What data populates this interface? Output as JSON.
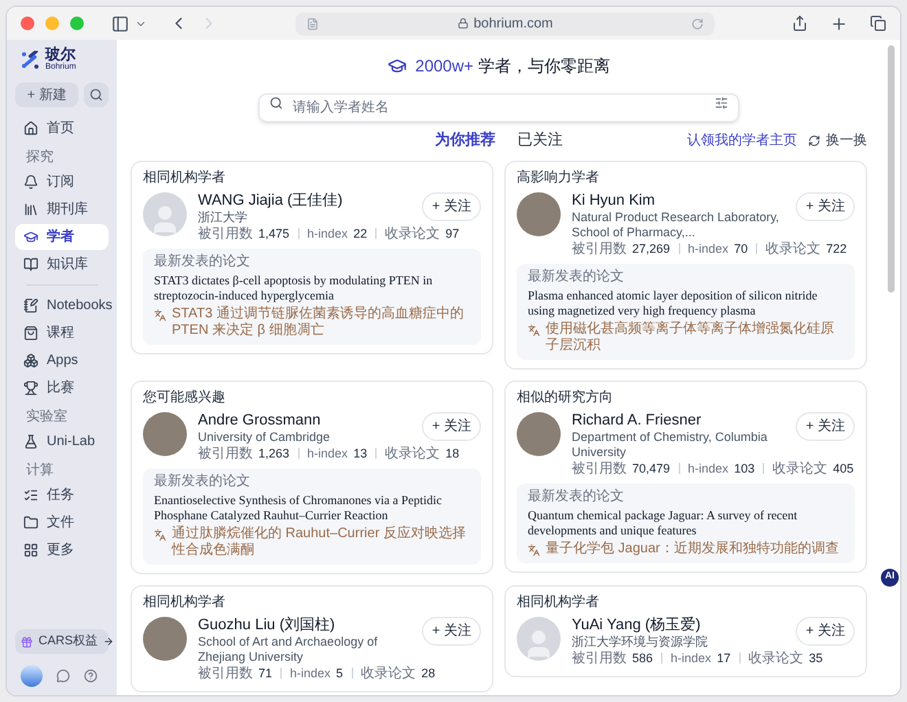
{
  "browser": {
    "address": "bohrium.com"
  },
  "sidebar": {
    "logo": {
      "name": "玻尔",
      "sub": "Bohrium"
    },
    "new_button": "+ 新建",
    "items": [
      {
        "kind": "item",
        "label": "首页",
        "selected": false
      },
      {
        "kind": "section",
        "label": "探究"
      },
      {
        "kind": "item",
        "label": "订阅",
        "selected": false
      },
      {
        "kind": "item",
        "label": "期刊库",
        "selected": false
      },
      {
        "kind": "item",
        "label": "学者",
        "selected": true
      },
      {
        "kind": "item",
        "label": "知识库",
        "selected": false
      },
      {
        "kind": "divider"
      },
      {
        "kind": "item",
        "label": "Notebooks",
        "selected": false
      },
      {
        "kind": "item",
        "label": "课程",
        "selected": false
      },
      {
        "kind": "item",
        "label": "Apps",
        "selected": false
      },
      {
        "kind": "item",
        "label": "比赛",
        "selected": false
      },
      {
        "kind": "section",
        "label": "实验室"
      },
      {
        "kind": "item",
        "label": "Uni-Lab",
        "selected": false
      },
      {
        "kind": "section",
        "label": "计算"
      },
      {
        "kind": "item",
        "label": "任务",
        "selected": false
      },
      {
        "kind": "item",
        "label": "文件",
        "selected": false
      },
      {
        "kind": "item",
        "label": "更多",
        "selected": false
      }
    ],
    "promo": "CARS权益"
  },
  "hero": {
    "highlight": "2000w+",
    "title": " 学者，与你零距离"
  },
  "search": {
    "placeholder": "请输入学者姓名"
  },
  "tabs": [
    {
      "label": "为你推荐",
      "selected": true
    },
    {
      "label": "已关注",
      "selected": false
    }
  ],
  "claim_link": "认领我的学者主页",
  "refresh": "换一换",
  "cards": [
    {
      "category": "相同机构学者",
      "has_photo": false,
      "name": "WANG Jiajia (王佳佳)",
      "affiliation": "浙江大学",
      "follow": "+ 关注",
      "citations_label": "被引用数",
      "citations": "1,475",
      "hindex_label": "h-index",
      "hindex": "22",
      "papers_label": "收录论文",
      "papers": "97",
      "paper_label": "最新发表的论文",
      "paper_title": "STAT3 dictates β-cell apoptosis by modulating PTEN in streptozocin-induced hyperglycemia",
      "paper_translation": "STAT3 通过调节链脲佐菌素诱导的高血糖症中的 PTEN 来决定 β 细胞凋亡"
    },
    {
      "category": "高影响力学者",
      "has_photo": true,
      "name": "Ki Hyun Kim",
      "affiliation": "Natural Product Research Laboratory, School of Pharmacy,...",
      "follow": "+ 关注",
      "citations_label": "被引用数",
      "citations": "27,269",
      "hindex_label": "h-index",
      "hindex": "70",
      "papers_label": "收录论文",
      "papers": "722",
      "paper_label": "最新发表的论文",
      "paper_title": "Plasma enhanced atomic layer deposition of silicon nitride using magnetized very high frequency plasma",
      "paper_translation": "使用磁化甚高频等离子体等离子体增强氮化硅原子层沉积"
    },
    {
      "category": "您可能感兴趣",
      "has_photo": true,
      "name": "Andre Grossmann",
      "affiliation": "University of Cambridge",
      "follow": "+ 关注",
      "citations_label": "被引用数",
      "citations": "1,263",
      "hindex_label": "h-index",
      "hindex": "13",
      "papers_label": "收录论文",
      "papers": "18",
      "paper_label": "最新发表的论文",
      "paper_title": "Enantioselective Synthesis of Chromanones via a Peptidic Phosphane Catalyzed Rauhut–Currier Reaction",
      "paper_translation": "通过肽膦烷催化的 Rauhut–Currier 反应对映选择性合成色满酮"
    },
    {
      "category": "相似的研究方向",
      "has_photo": true,
      "name": "Richard A. Friesner",
      "affiliation": "Department of Chemistry, Columbia University",
      "follow": "+ 关注",
      "citations_label": "被引用数",
      "citations": "70,479",
      "hindex_label": "h-index",
      "hindex": "103",
      "papers_label": "收录论文",
      "papers": "405",
      "paper_label": "最新发表的论文",
      "paper_title": "Quantum chemical package Jaguar: A survey of recent developments and unique features",
      "paper_translation": "量子化学包 Jaguar：近期发展和独特功能的调查"
    },
    {
      "category": "相同机构学者",
      "has_photo": true,
      "name": "Guozhu Liu (刘国柱)",
      "affiliation": "School of Art and Archaeology of Zhejiang University",
      "follow": "+ 关注",
      "citations_label": "被引用数",
      "citations": "71",
      "hindex_label": "h-index",
      "hindex": "5",
      "papers_label": "收录论文",
      "papers": "28"
    },
    {
      "category": "相同机构学者",
      "has_photo": false,
      "name": "YuAi Yang (杨玉爱)",
      "affiliation": "浙江大学环境与资源学院",
      "follow": "+ 关注",
      "citations_label": "被引用数",
      "citations": "586",
      "hindex_label": "h-index",
      "hindex": "17",
      "papers_label": "收录论文",
      "papers": "35"
    }
  ],
  "ai_badge": "AI"
}
